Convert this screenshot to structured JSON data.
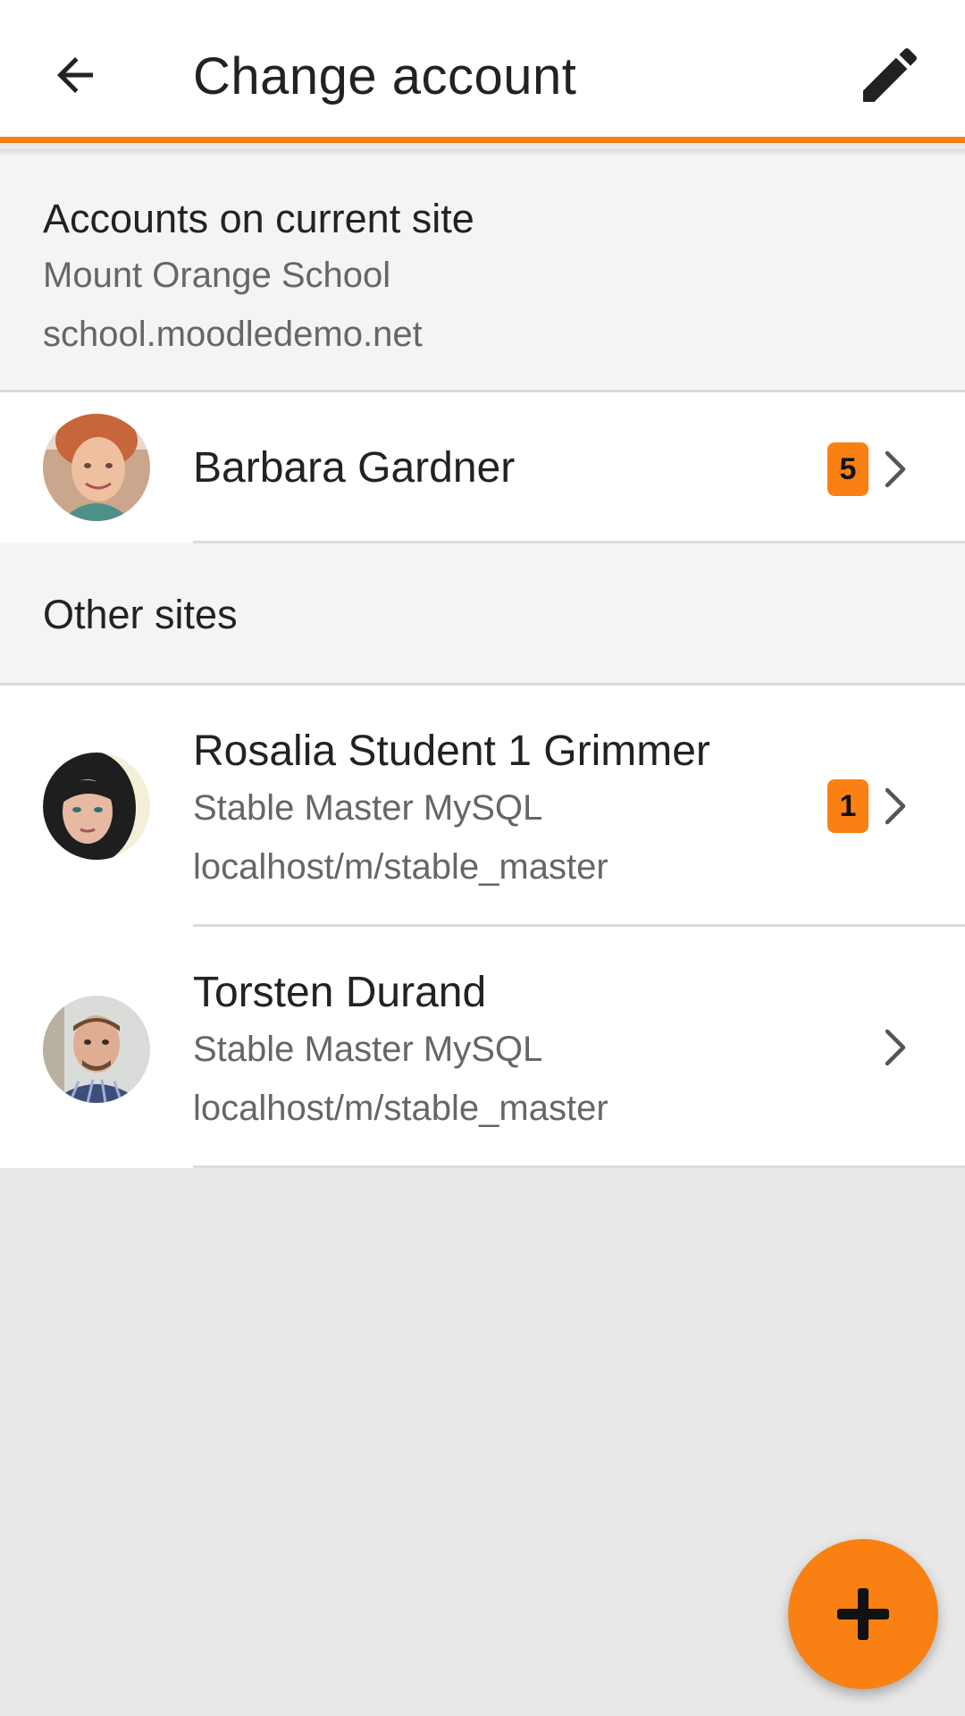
{
  "header": {
    "title": "Change account",
    "back_icon": "arrow-back-icon",
    "edit_icon": "pencil-icon"
  },
  "current_site": {
    "section_title": "Accounts on current site",
    "site_name": "Mount Orange School",
    "site_url": "school.moodledemo.net",
    "accounts": [
      {
        "name": "Barbara Gardner",
        "badge": "5"
      }
    ]
  },
  "other_sites": {
    "section_title": "Other sites",
    "accounts": [
      {
        "name": "Rosalia Student 1 Grimmer",
        "site_name": "Stable Master MySQL",
        "site_url": "localhost/m/stable_master",
        "badge": "1"
      },
      {
        "name": "Torsten Durand",
        "site_name": "Stable Master MySQL",
        "site_url": "localhost/m/stable_master"
      }
    ]
  },
  "fab": {
    "icon": "plus-icon"
  },
  "colors": {
    "accent": "#f98012",
    "header_bg": "#ffffff",
    "section_bg": "#f4f4f4",
    "page_bg": "#e8e8e8",
    "text_primary": "#222222",
    "text_secondary": "#666666"
  }
}
